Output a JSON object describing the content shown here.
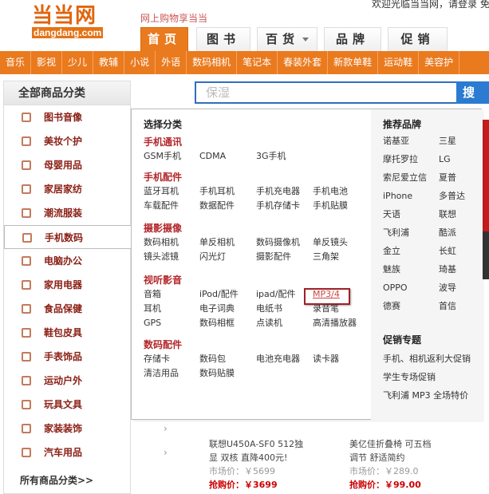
{
  "header": {
    "logo_cn": "当当网",
    "logo_en": "dangdang.com",
    "slogan": "网上购物享当当",
    "welcome": "欢迎光临当当网，请登录 免"
  },
  "tabs": [
    {
      "label": "首页",
      "active": true
    },
    {
      "label": "图书"
    },
    {
      "label": "百货",
      "dropdown": true
    },
    {
      "label": "品牌"
    },
    {
      "label": "促销"
    }
  ],
  "category_bar": [
    "音乐",
    "影视",
    "少儿",
    "教辅",
    "小说",
    "外语",
    "数码相机",
    "笔记本",
    "春装外套",
    "新款单鞋",
    "运动鞋",
    "美容护"
  ],
  "search": {
    "placeholder": "保湿",
    "button": "搜 索"
  },
  "left_menu": {
    "title": "全部商品分类",
    "items": [
      {
        "label": "图书音像",
        "icon": "book-icon"
      },
      {
        "label": "美妆个护",
        "icon": "cosmetic-icon"
      },
      {
        "label": "母婴用品",
        "icon": "baby-icon"
      },
      {
        "label": "家居家纺",
        "icon": "home-icon"
      },
      {
        "label": "潮流服装",
        "icon": "shirt-icon"
      },
      {
        "label": "手机数码",
        "icon": "phone-icon",
        "active": true
      },
      {
        "label": "电脑办公",
        "icon": "computer-icon"
      },
      {
        "label": "家用电器",
        "icon": "appliance-icon"
      },
      {
        "label": "食品保健",
        "icon": "food-icon"
      },
      {
        "label": "鞋包皮具",
        "icon": "shoe-icon"
      },
      {
        "label": "手表饰品",
        "icon": "watch-icon"
      },
      {
        "label": "运动户外",
        "icon": "sport-icon"
      },
      {
        "label": "玩具文具",
        "icon": "toy-icon"
      },
      {
        "label": "家装装饰",
        "icon": "decor-icon"
      },
      {
        "label": "汽车用品",
        "icon": "car-icon"
      }
    ],
    "all_link": "所有商品分类>>",
    "arrow": "›"
  },
  "flyout": {
    "select_title": "选择分类",
    "groups": [
      {
        "title": "手机通讯",
        "items": [
          "GSM手机",
          "CDMA",
          "3G手机"
        ]
      },
      {
        "title": "手机配件",
        "items": [
          "蓝牙耳机",
          "手机耳机",
          "手机充电器",
          "手机电池",
          "车载配件",
          "数据配件",
          "手机存储卡",
          "手机贴膜"
        ]
      },
      {
        "title": "摄影摄像",
        "items": [
          "数码相机",
          "单反相机",
          "数码摄像机",
          "单反镜头",
          "镜头滤镜",
          "闪光灯",
          "摄影配件",
          "三角架"
        ]
      },
      {
        "title": "视听影音",
        "items": [
          "音箱",
          "iPod/配件",
          "ipad/配件",
          "MP3/4",
          "耳机",
          "电子词典",
          "电纸书",
          "录音笔",
          "GPS",
          "数码相框",
          "点读机",
          "高清播放器"
        ]
      },
      {
        "title": "数码配件",
        "items": [
          "存储卡",
          "数码包",
          "电池充电器",
          "读卡器",
          "清洁用品",
          "数码贴膜"
        ]
      }
    ],
    "brands_title": "推荐品牌",
    "brands": [
      "诺基亚",
      "三星",
      "摩托罗拉",
      "LG",
      "索尼爱立信",
      "夏普",
      "iPhone",
      "多普达",
      "天语",
      "联想",
      "飞利浦",
      "酷派",
      "金立",
      "长虹",
      "魅族",
      "琦基",
      "OPPO",
      "波导",
      "德赛",
      "首信"
    ],
    "promo_title": "促销专题",
    "promos": [
      "手机、相机返利大促销",
      "学生专场促销",
      "飞利浦 MP3 全场特价"
    ]
  },
  "products": [
    {
      "name1": "联想U450A-SF0 512独",
      "name2": "显 双核 直降400元!",
      "market": "市场价：￥5699",
      "price": "抢购价：￥3699"
    },
    {
      "name1": "美亿佳折叠椅 可五档",
      "name2": "调节 舒适简约",
      "market": "市场价：￥289.0",
      "price": "抢购价：￥99.00"
    }
  ],
  "colors": {
    "orange": "#ea7a1e",
    "blue": "#2a7bd1",
    "red_title": "#b3272b",
    "price": "#cc0000"
  }
}
